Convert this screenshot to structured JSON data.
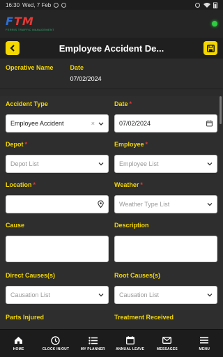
{
  "status": {
    "time": "16:30",
    "date": "Wed, 7 Feb"
  },
  "brand": {
    "logo_f": "F",
    "logo_tm": "TM",
    "tagline": "FERRIS TRAFFIC MANAGEMENT"
  },
  "header": {
    "title": "Employee Accident De..."
  },
  "info": {
    "operative_label": "Operative Name",
    "operative_value": "",
    "date_label": "Date",
    "date_value": "07/02/2024"
  },
  "form": {
    "accident_type": {
      "label": "Accident Type",
      "value": "Employee Accident"
    },
    "date": {
      "label": "Date",
      "value": "07/02/2024"
    },
    "depot": {
      "label": "Depot",
      "placeholder": "Depot List"
    },
    "employee": {
      "label": "Employee",
      "placeholder": "Employee List"
    },
    "location": {
      "label": "Location",
      "value": ""
    },
    "weather": {
      "label": "Weather",
      "placeholder": "Weather Type List"
    },
    "cause": {
      "label": "Cause"
    },
    "description": {
      "label": "Description"
    },
    "direct_causes": {
      "label": "Direct Causes(s)",
      "placeholder": "Causation List"
    },
    "root_causes": {
      "label": "Root Causes(s)",
      "placeholder": "Causation List"
    },
    "parts_injured": {
      "label": "Parts Injured"
    },
    "treatment_received": {
      "label": "Treatment Received"
    }
  },
  "nav": [
    {
      "label": "HOME"
    },
    {
      "label": "CLOCK IN/OUT"
    },
    {
      "label": "MY PLANNER"
    },
    {
      "label": "ANNUAL LEAVE"
    },
    {
      "label": "MESSAGES"
    },
    {
      "label": "MENU"
    }
  ],
  "colors": {
    "accent": "#f5d800",
    "required": "#e53935",
    "online": "#2ecc40"
  }
}
